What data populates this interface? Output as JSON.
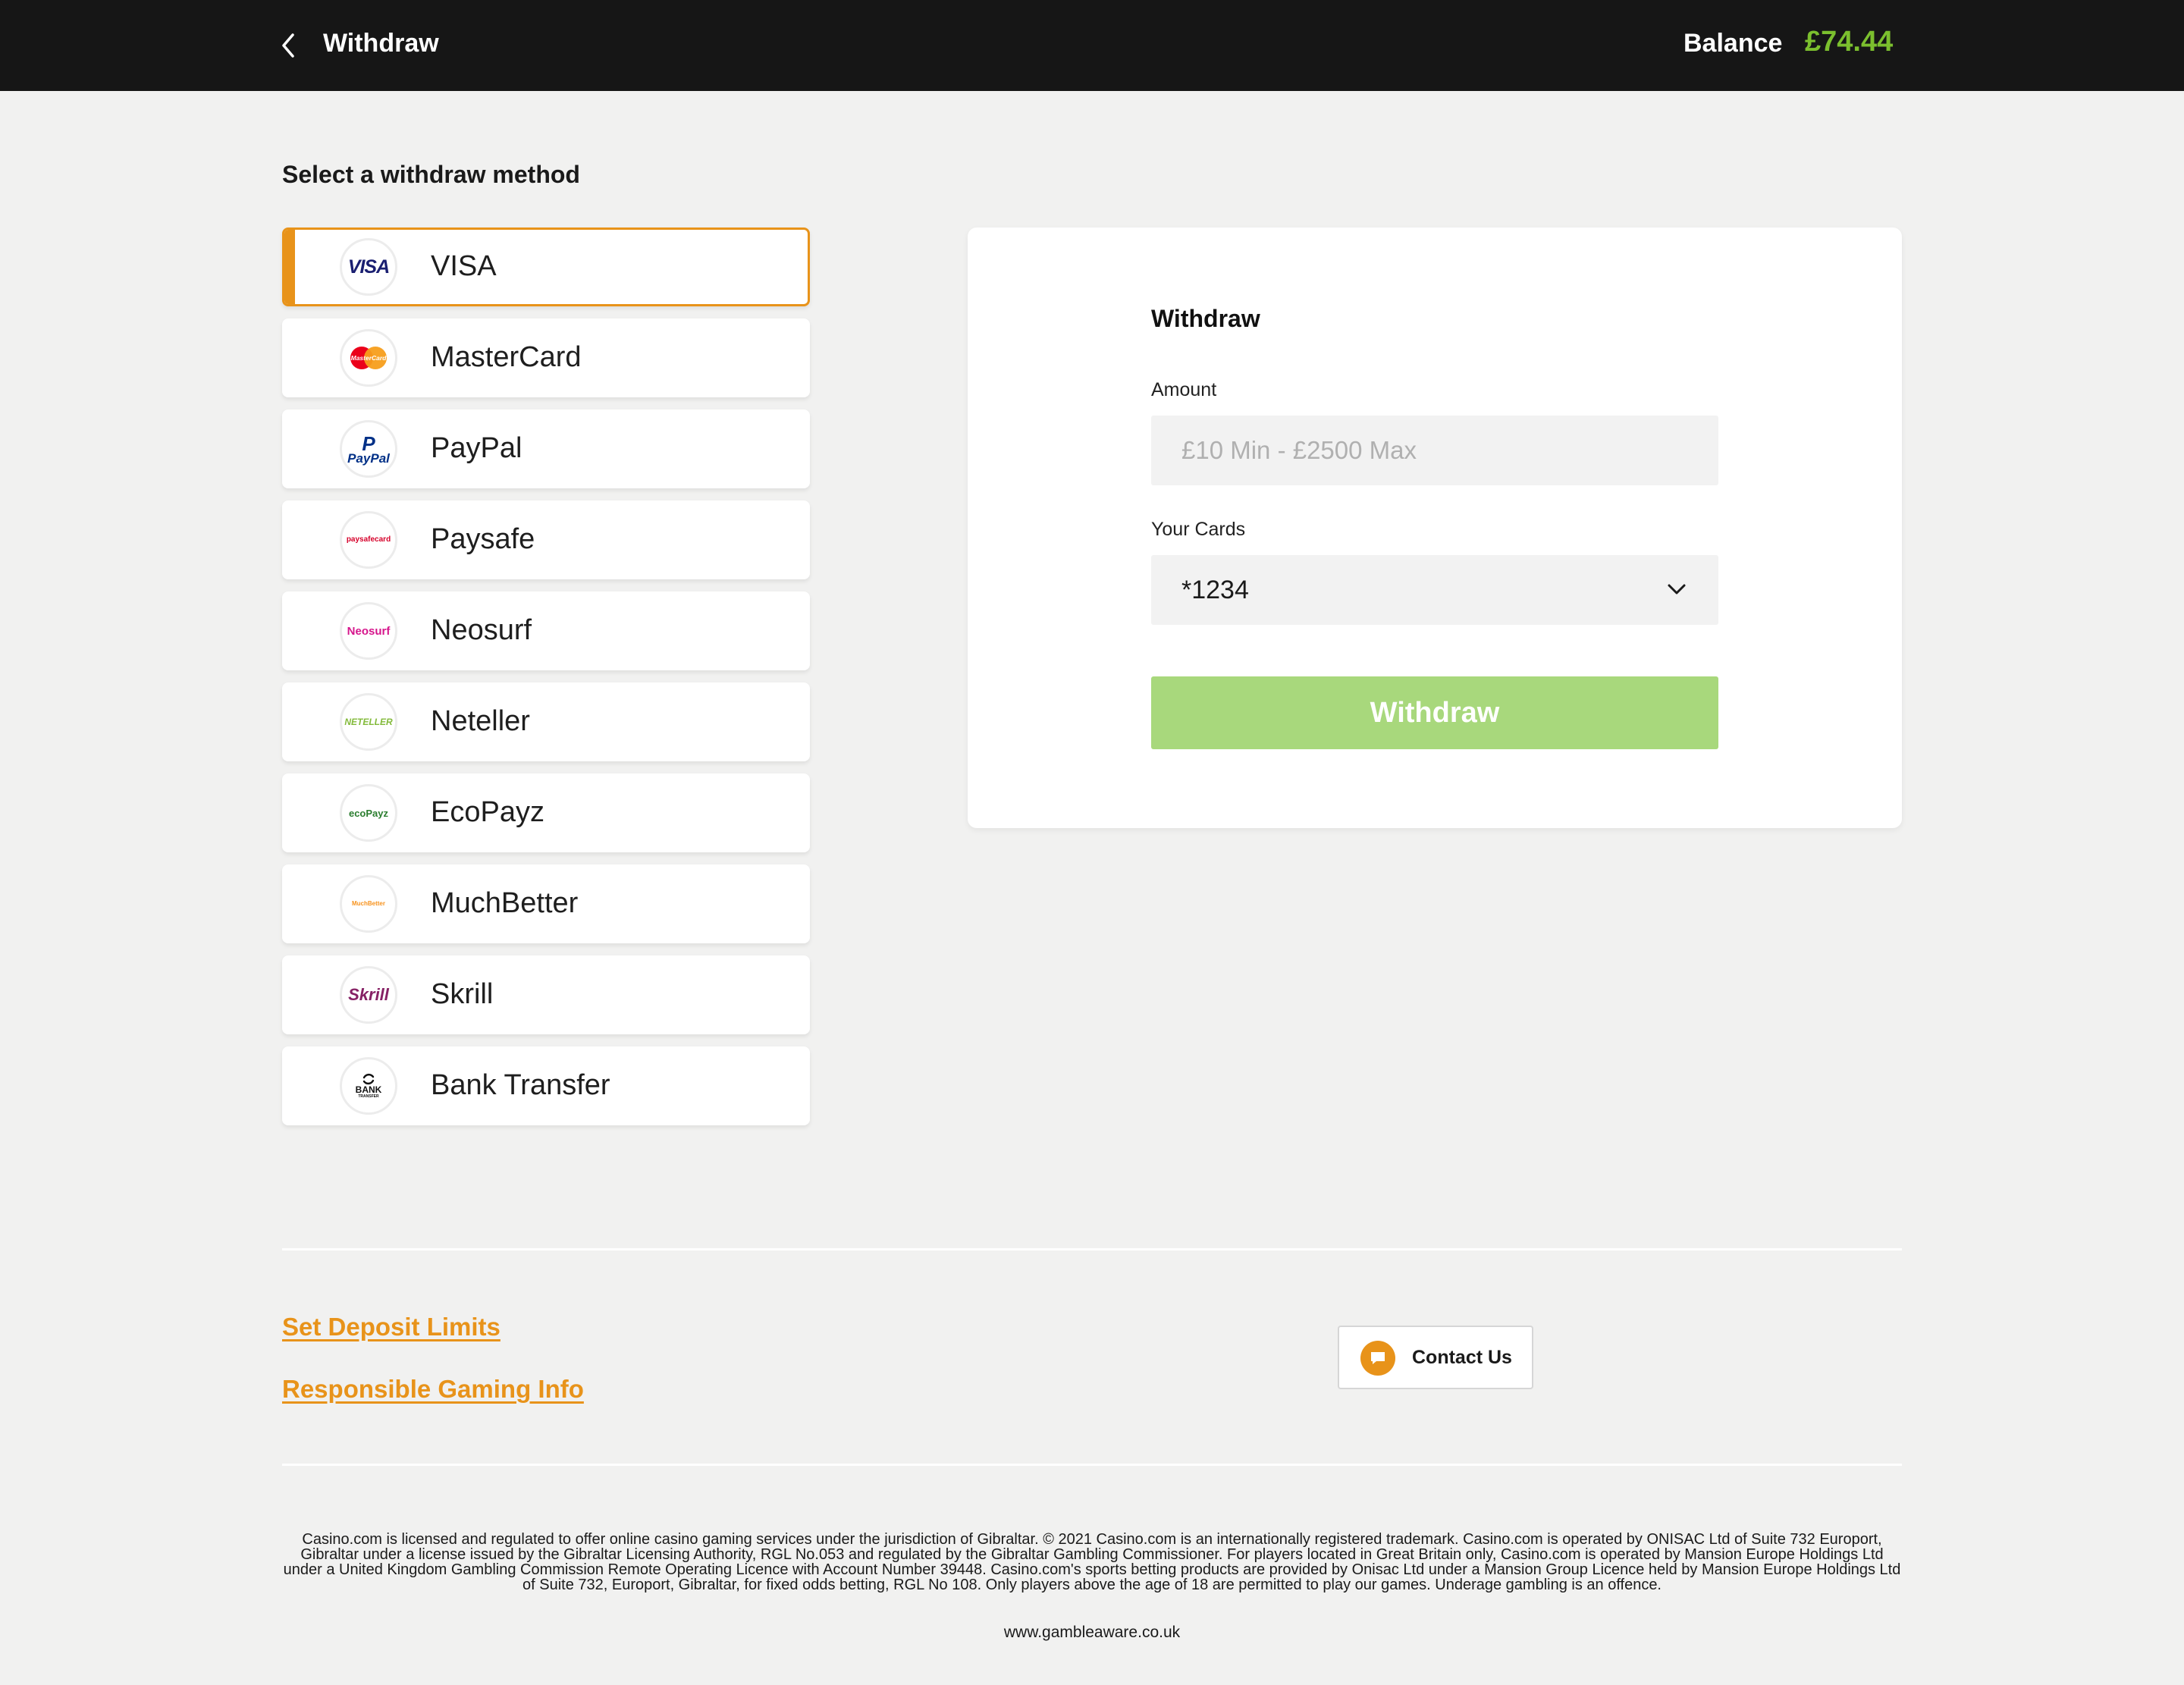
{
  "header": {
    "title": "Withdraw",
    "balance_label": "Balance",
    "balance_value": "£74.44"
  },
  "methods_section": {
    "title": "Select a withdraw method",
    "selected": "VISA",
    "items": [
      {
        "label": "VISA",
        "logo_text": "VISA",
        "logo_color": "#1a1f71"
      },
      {
        "label": "MasterCard",
        "logo_text": "MasterCard",
        "logo_color": "#eb001b"
      },
      {
        "label": "PayPal",
        "logo_text": "PayPal",
        "logo_color": "#003087"
      },
      {
        "label": "Paysafe",
        "logo_text": "paysafecard",
        "logo_color": "#d6002a"
      },
      {
        "label": "Neosurf",
        "logo_text": "Neosurf",
        "logo_color": "#d6168c"
      },
      {
        "label": "Neteller",
        "logo_text": "NETELLER",
        "logo_color": "#83ba3b"
      },
      {
        "label": "EcoPayz",
        "logo_text": "ecoPayz",
        "logo_color": "#2a7d2e"
      },
      {
        "label": "MuchBetter",
        "logo_text": "MuchBetter",
        "logo_color": "#f7931e"
      },
      {
        "label": "Skrill",
        "logo_text": "Skrill",
        "logo_color": "#862165"
      },
      {
        "label": "Bank Transfer",
        "logo_text": "BANK",
        "logo_subtext": "TRANSFER",
        "logo_color": "#111111"
      }
    ]
  },
  "withdraw_panel": {
    "title": "Withdraw",
    "amount_label": "Amount",
    "amount_placeholder": "£10 Min - £2500 Max",
    "cards_label": "Your Cards",
    "cards_selected": "*1234",
    "submit_label": "Withdraw"
  },
  "footer": {
    "links": [
      "Set Deposit Limits",
      "Responsible Gaming Info"
    ],
    "contact_label": "Contact Us",
    "legal_text": "Casino.com is licensed and regulated to offer online casino gaming services under the jurisdiction of Gibraltar. © 2021 Casino.com is an internationally registered trademark. Casino.com is operated by ONISAC Ltd of Suite 732 Europort, Gibraltar under a license issued by the Gibraltar Licensing Authority, RGL No.053 and regulated by the Gibraltar Gambling Commissioner. For players located in Great Britain only, Casino.com is operated by Mansion Europe Holdings Ltd under a United Kingdom Gambling Commission Remote Operating Licence with Account Number 39448. Casino.com's sports betting products are provided by Onisac Ltd under a Mansion Group Licence held by Mansion Europe Holdings Ltd of Suite 732, Europort, Gibraltar, for fixed odds betting, RGL No 108. Only players above the age of 18 are permitted to play our games. Underage gambling is an offence.",
    "gambleaware": "www.gambleaware.co.uk"
  },
  "colors": {
    "accent": "#e8931a",
    "balance": "#7bbf2e",
    "button": "#a8d87c",
    "topbar": "#161616"
  },
  "icons": {
    "back": "chevron-left-icon",
    "dropdown": "chevron-down-icon",
    "contact": "chat-bubble-icon"
  }
}
